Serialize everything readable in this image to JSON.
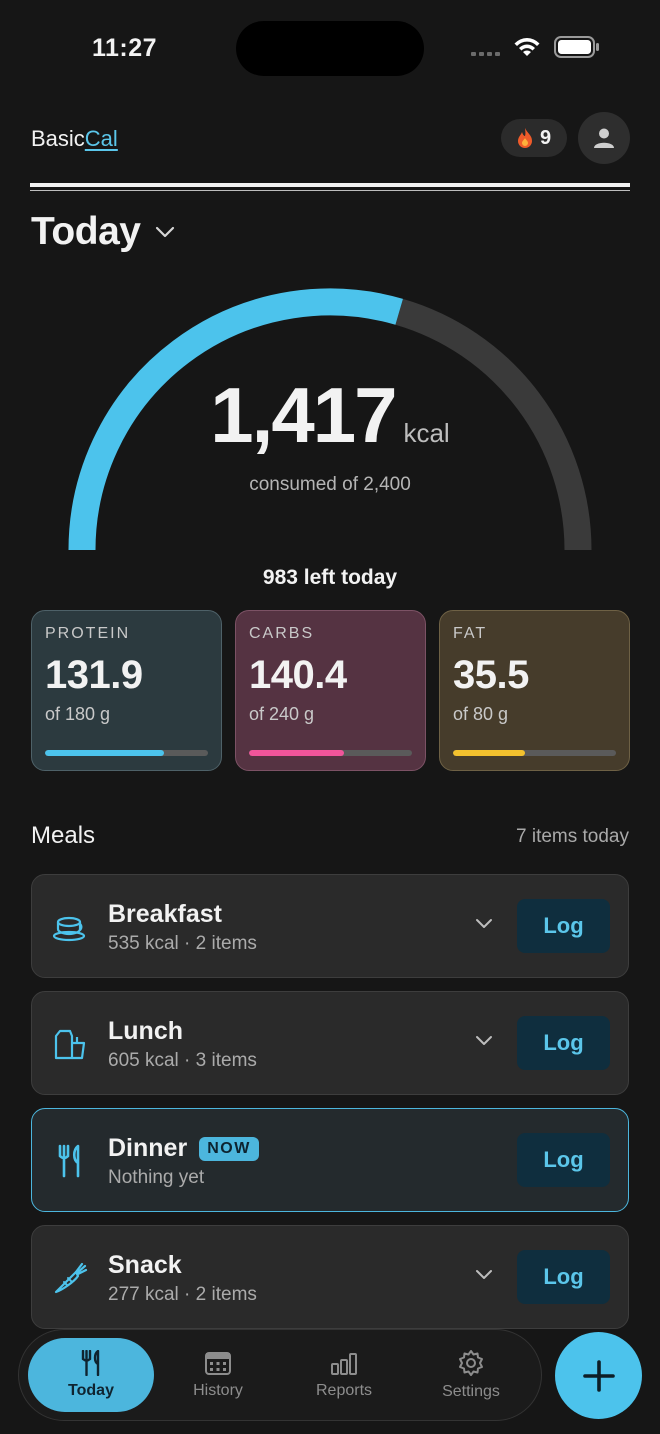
{
  "status": {
    "time": "11:27"
  },
  "header": {
    "brand_prefix": "Basic",
    "brand_suffix": "Cal",
    "streak_count": "9"
  },
  "date_title": "Today",
  "calories": {
    "consumed": "1,417",
    "unit": "kcal",
    "consumed_text": "consumed of 2,400",
    "left_text": "983 left today",
    "progress_fraction": 0.59,
    "gauge_color": "#4cc3ec",
    "track_color": "#3a3a3a"
  },
  "macros": [
    {
      "label": "PROTEIN",
      "value": "131.9",
      "of": "of 180 g",
      "fraction": 0.733,
      "color": "#4cc3ec"
    },
    {
      "label": "CARBS",
      "value": "140.4",
      "of": "of 240 g",
      "fraction": 0.585,
      "color": "#f0559a"
    },
    {
      "label": "FAT",
      "value": "35.5",
      "of": "of 80 g",
      "fraction": 0.444,
      "color": "#f2c12e"
    }
  ],
  "meals_section": {
    "title": "Meals",
    "count": "7 items today"
  },
  "meals": [
    {
      "name": "Breakfast",
      "meta": "535 kcal · 2 items",
      "log": "Log",
      "icon": "cup-icon"
    },
    {
      "name": "Lunch",
      "meta": "605 kcal · 3 items",
      "log": "Log",
      "icon": "lunch-bag-icon"
    },
    {
      "name": "Dinner",
      "badge": "NOW",
      "meta": "Nothing yet",
      "log": "Log",
      "icon": "fork-knife-icon"
    },
    {
      "name": "Snack",
      "meta": "277 kcal · 2 items",
      "log": "Log",
      "icon": "carrot-icon"
    }
  ],
  "nav": [
    {
      "label": "Today",
      "icon": "fork-knife-icon",
      "active": true
    },
    {
      "label": "History",
      "icon": "calendar-icon"
    },
    {
      "label": "Reports",
      "icon": "bar-chart-icon"
    },
    {
      "label": "Settings",
      "icon": "gear-icon"
    }
  ],
  "fab_icon": "plus-icon"
}
